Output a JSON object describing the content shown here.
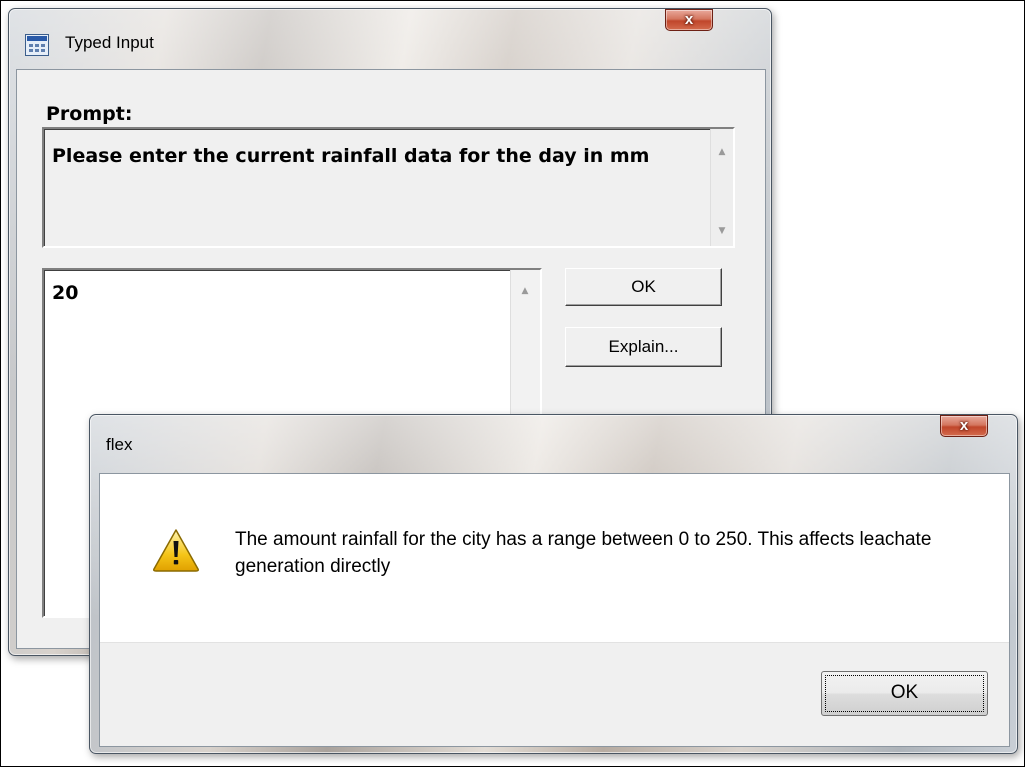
{
  "typed_input_dialog": {
    "title": "Typed Input",
    "close_glyph": "x",
    "prompt_label": "Prompt:",
    "prompt_text": "Please enter the current rainfall data for the day in mm",
    "input_value": "20",
    "ok_label": "OK",
    "explain_label": "Explain...",
    "icon": "application-form-icon"
  },
  "message_box": {
    "title": "flex",
    "close_glyph": "x",
    "message": "The amount rainfall for the city has a range between 0 to 250. This affects leachate generation directly",
    "ok_label": "OK",
    "icon": "warning-icon"
  },
  "colors": {
    "close_button": "#c7472b",
    "warning_yellow": "#f5c518",
    "dialog_face": "#f0f0f0"
  }
}
